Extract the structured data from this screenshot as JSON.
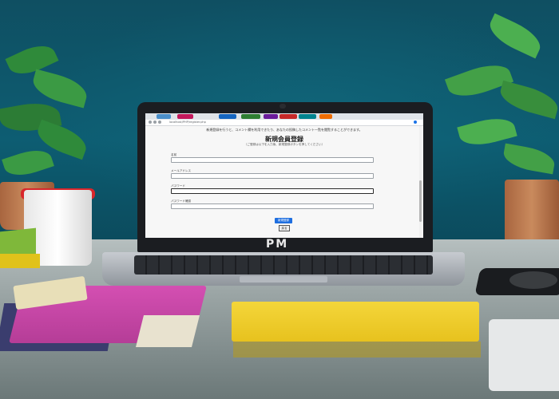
{
  "brand": {
    "logo": "PM"
  },
  "browser": {
    "tabs": [
      {
        "label": "",
        "color": "#4a8ec9"
      },
      {
        "label": "",
        "color": "#c2185b"
      },
      {
        "label": "",
        "color": "#1565c0"
      },
      {
        "label": "",
        "color": "#2e7d32"
      },
      {
        "label": "",
        "color": "#6a1b9a"
      },
      {
        "label": "",
        "color": "#c62828"
      },
      {
        "label": "",
        "color": "#00838f"
      },
      {
        "label": "",
        "color": "#ef6c00"
      }
    ],
    "url": "localhost/PHP/register.php"
  },
  "page": {
    "notice": "新規登録を行うと、コメント欄を利用できたり、あなたの投稿したコメント一覧を閲覧することができます。",
    "title": "新規会員登録",
    "subtitle": "（ご登録は以下を入力後、新規登録ボタンを押してください）",
    "fields": [
      {
        "label": "名前",
        "value": ""
      },
      {
        "label": "メールアドレス",
        "value": ""
      },
      {
        "label": "パスワード",
        "value": ""
      },
      {
        "label": "パスワード確認",
        "value": ""
      }
    ],
    "submit_label": "新規登録",
    "back_label": "戻る"
  },
  "colors": {
    "primary": "#1f6fe0"
  }
}
